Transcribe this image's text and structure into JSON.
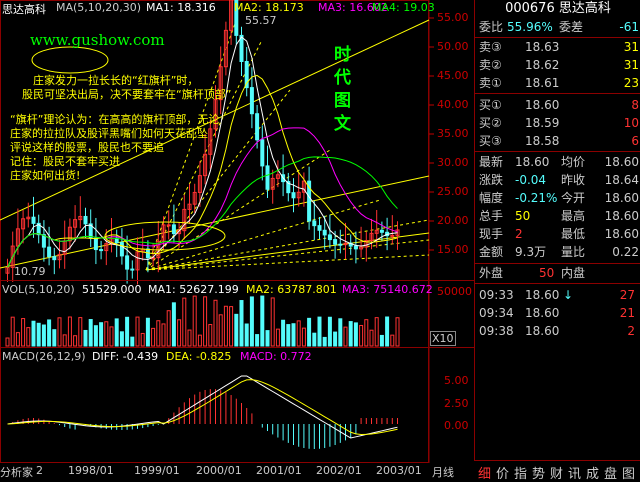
{
  "header": {
    "stock_name": "思达高科",
    "ma_label": "MA(5,10,20,30)",
    "ma1": "MA1: 18.316",
    "ma2": "MA2: 18.173",
    "ma3": "MA3: 16.602",
    "ma4": "MA4: 19.03"
  },
  "annotations": {
    "website": "www.gushow.com",
    "times_chars": [
      "时",
      "代",
      "图",
      "文"
    ],
    "line1": "庄家发力一拉长长的“红旗杆”时，",
    "line2": "股民可坚决出局，决不要套牢在“旗杆顶部”",
    "theory1": "“旗杆”理论认为：在高高的旗杆顶部，无论",
    "theory2": "庄家的拉拉队及股评黑嘴们如何天花乱坠",
    "theory3": "评说这样的股票，股民也不要追",
    "theory4": "记住：股民不套牢买进",
    "theory5": "庄家如何出货!",
    "high_label": "55.57",
    "low_label": "10.79"
  },
  "price_axis": [
    "55.00",
    "50.00",
    "45.00",
    "40.00",
    "35.00",
    "30.00",
    "25.00",
    "20.00",
    "15.00"
  ],
  "vol": {
    "label": "VOL(5,10,20)",
    "value": "51529.000",
    "ma1": "MA1: 52627.199",
    "ma2": "MA2: 63787.801",
    "ma3": "MA3: 75140.672",
    "axis_top": "50000",
    "multiplier": "X10"
  },
  "macd": {
    "label": "MACD(26,12,9)",
    "diff": "DIFF: -0.439",
    "dea": "DEA: -0.825",
    "macd": "MACD: 0.772",
    "axis": [
      "5.00",
      "2.50",
      "0.00"
    ]
  },
  "x_axis": {
    "left_label": "分析家",
    "left_num": "2",
    "ticks": [
      "1998/01",
      "1999/01",
      "2000/01",
      "2001/01",
      "2002/01",
      "2003/01"
    ],
    "period": "月线"
  },
  "quote": {
    "code": "000676",
    "name": "思达高科",
    "weibi_label": "委比",
    "weibi_value": "55.96%",
    "weicha_label": "委差",
    "weicha_value": "-61",
    "sells": [
      {
        "label": "卖③",
        "price": "18.63",
        "vol": "31"
      },
      {
        "label": "卖②",
        "price": "18.62",
        "vol": "31"
      },
      {
        "label": "卖①",
        "price": "18.61",
        "vol": "23"
      }
    ],
    "buys": [
      {
        "label": "买①",
        "price": "18.60",
        "vol": "8"
      },
      {
        "label": "买②",
        "price": "18.59",
        "vol": "10"
      },
      {
        "label": "买③",
        "price": "18.58",
        "vol": "6"
      }
    ],
    "stats": [
      {
        "l1": "最新",
        "v1": "18.60",
        "l2": "均价",
        "v2": "18.60"
      },
      {
        "l1": "涨跌",
        "v1": "-0.04",
        "l2": "昨收",
        "v2": "18.64"
      },
      {
        "l1": "幅度",
        "v1": "-0.21%",
        "l2": "今开",
        "v2": "18.60"
      },
      {
        "l1": "总手",
        "v1": "50",
        "l2": "最高",
        "v2": "18.60"
      },
      {
        "l1": "现手",
        "v1": "2",
        "l2": "最低",
        "v2": "18.60"
      },
      {
        "l1": "金额",
        "v1": "9.3万",
        "l2": "量比",
        "v2": "0.22"
      }
    ],
    "outer_label": "外盘",
    "outer_value": "50",
    "inner_label": "内盘",
    "ticks": [
      {
        "time": "09:33",
        "price": "18.60",
        "arrow": "↓",
        "vol": "27"
      },
      {
        "time": "09:34",
        "price": "18.60",
        "arrow": "",
        "vol": "21"
      },
      {
        "time": "09:38",
        "price": "18.60",
        "arrow": "",
        "vol": "2"
      }
    ]
  },
  "tabs": [
    "细",
    "价",
    "指",
    "势",
    "财",
    "讯",
    "成",
    "盘",
    "图"
  ],
  "colors": {
    "up": "#ff3232",
    "down": "#54fcfc",
    "ma1": "#ffffff",
    "ma2": "#ffff00",
    "ma3": "#ff00ff",
    "ma4": "#00ff00",
    "axis": "#c00000"
  }
}
